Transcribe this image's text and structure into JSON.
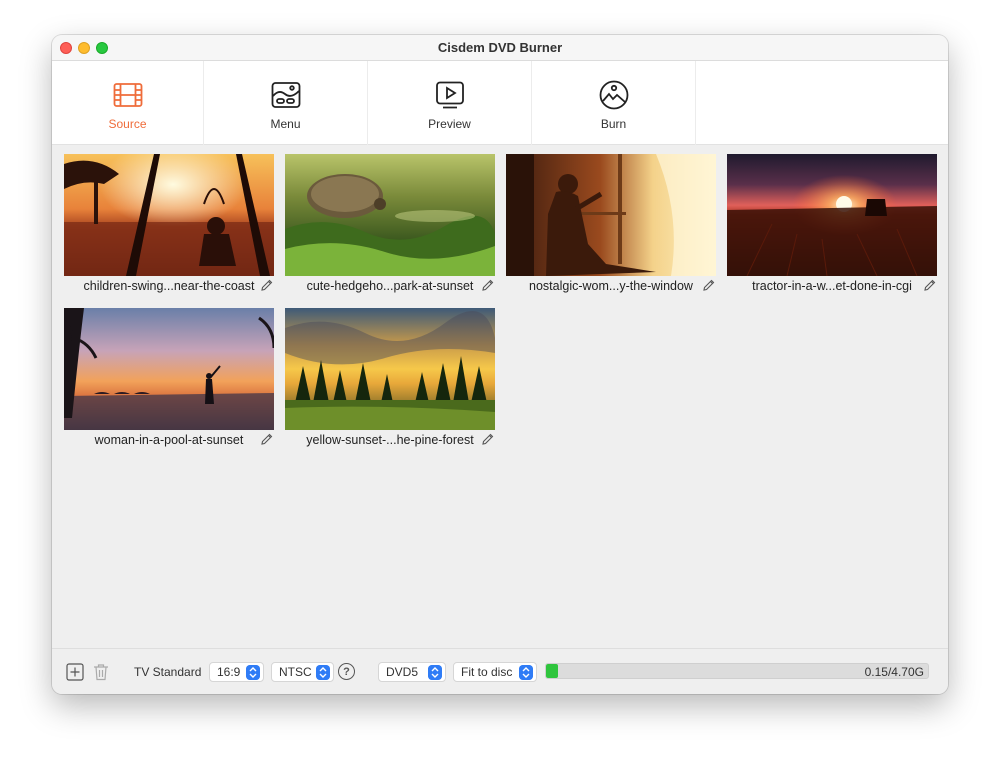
{
  "window": {
    "title": "Cisdem DVD Burner"
  },
  "toolbar": {
    "tabs": [
      {
        "label": "Source",
        "icon": "film-icon",
        "active": true
      },
      {
        "label": "Menu",
        "icon": "menu-layout-icon",
        "active": false
      },
      {
        "label": "Preview",
        "icon": "play-monitor-icon",
        "active": false
      },
      {
        "label": "Burn",
        "icon": "disc-icon",
        "active": false
      }
    ],
    "active_color": "#ef6c3a"
  },
  "videos": [
    {
      "name": "children-swing...near-the-coast"
    },
    {
      "name": "cute-hedgeho...park-at-sunset"
    },
    {
      "name": "nostalgic-wom...y-the-window"
    },
    {
      "name": "tractor-in-a-w...et-done-in-cgi"
    },
    {
      "name": "woman-in-a-pool-at-sunset"
    },
    {
      "name": "yellow-sunset-...he-pine-forest"
    }
  ],
  "statusbar": {
    "tv_standard_label": "TV Standard",
    "aspect_ratio": "16:9",
    "tv_standard": "NTSC",
    "help": "?",
    "disc_type": "DVD5",
    "fit_mode": "Fit to disc",
    "capacity_used": 0.15,
    "capacity_total": 4.7,
    "capacity_text": "0.15/4.70G",
    "capacity_color": "#2fc53d"
  }
}
